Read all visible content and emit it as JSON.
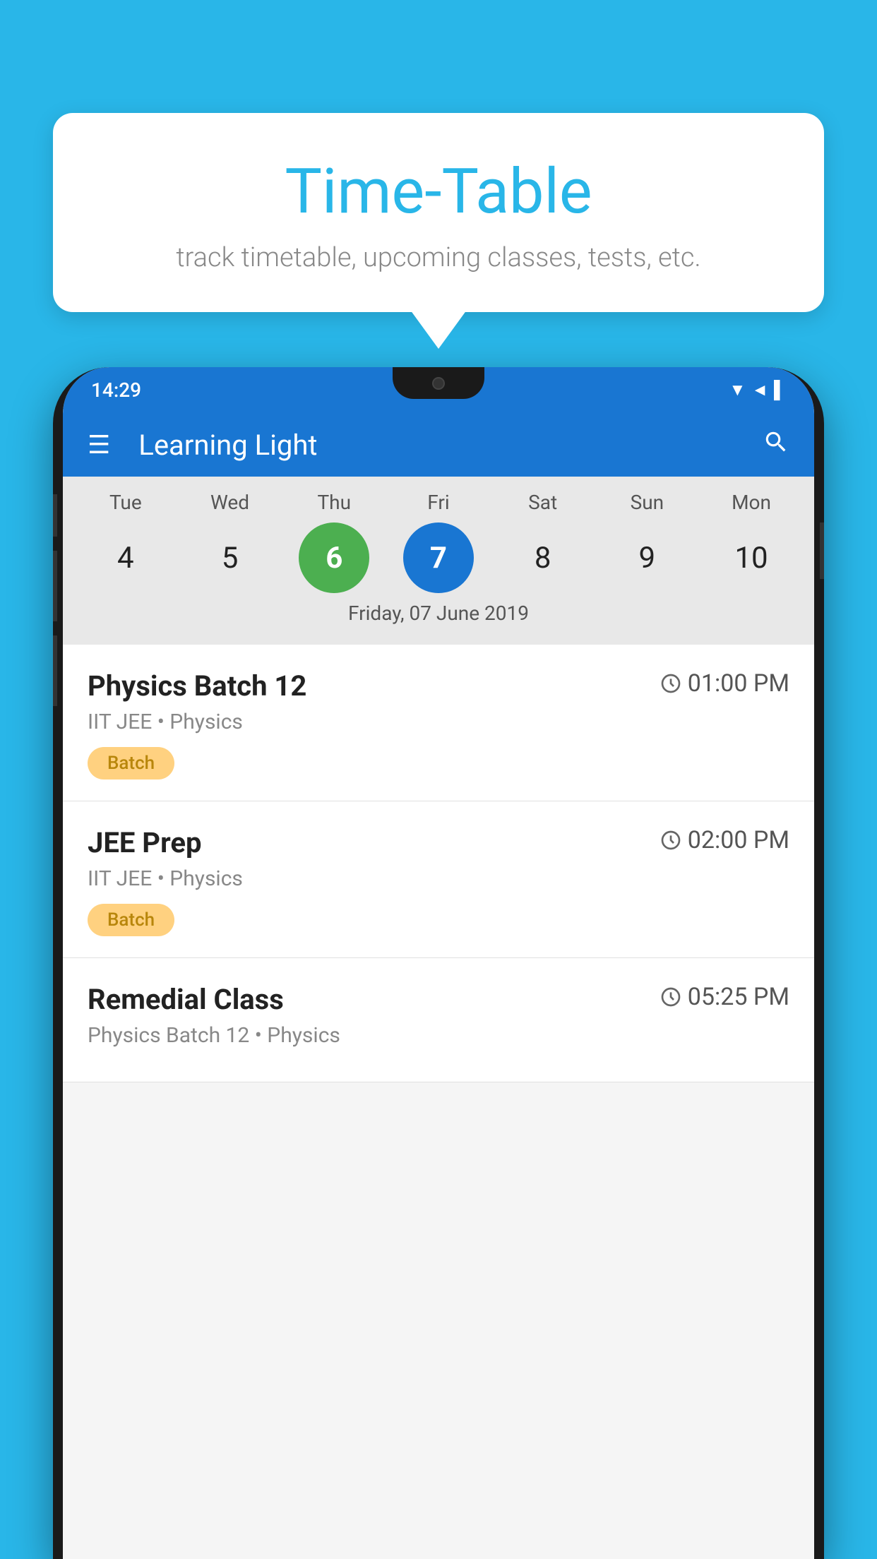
{
  "background_color": "#29b6e8",
  "bubble": {
    "title": "Time-Table",
    "subtitle": "track timetable, upcoming classes, tests, etc."
  },
  "status_bar": {
    "time": "14:29",
    "icons": "▼◄▌"
  },
  "app_bar": {
    "title": "Learning Light",
    "menu_icon": "☰",
    "search_icon": "🔍"
  },
  "calendar": {
    "days": [
      {
        "label": "Tue",
        "num": "4",
        "state": "normal"
      },
      {
        "label": "Wed",
        "num": "5",
        "state": "normal"
      },
      {
        "label": "Thu",
        "num": "6",
        "state": "today"
      },
      {
        "label": "Fri",
        "num": "7",
        "state": "selected"
      },
      {
        "label": "Sat",
        "num": "8",
        "state": "normal"
      },
      {
        "label": "Sun",
        "num": "9",
        "state": "normal"
      },
      {
        "label": "Mon",
        "num": "10",
        "state": "normal"
      }
    ],
    "selected_label": "Friday, 07 June 2019"
  },
  "schedule": [
    {
      "title": "Physics Batch 12",
      "time": "01:00 PM",
      "subtitle": "IIT JEE • Physics",
      "badge": "Batch"
    },
    {
      "title": "JEE Prep",
      "time": "02:00 PM",
      "subtitle": "IIT JEE • Physics",
      "badge": "Batch"
    },
    {
      "title": "Remedial Class",
      "time": "05:25 PM",
      "subtitle": "Physics Batch 12 • Physics",
      "badge": null
    }
  ]
}
